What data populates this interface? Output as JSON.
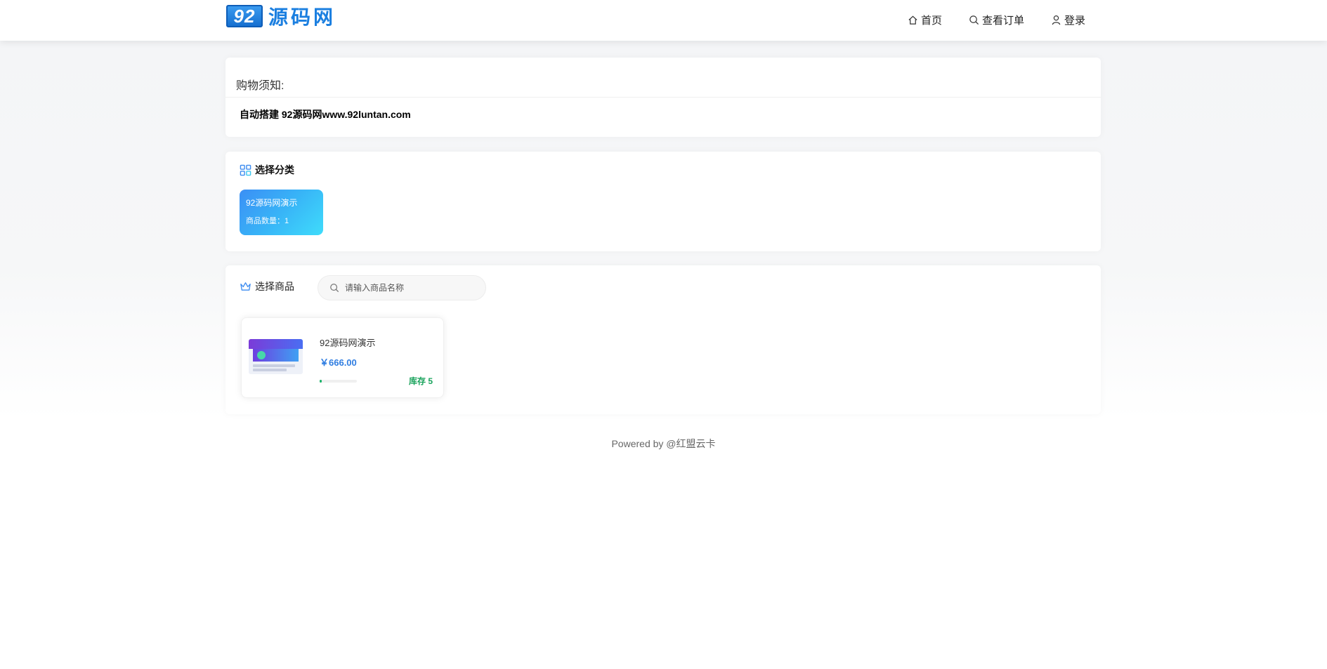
{
  "logo": {
    "badge": "92",
    "text": "源码网"
  },
  "nav": {
    "home": "首页",
    "orders": "查看订单",
    "login": "登录"
  },
  "notice": {
    "title": "购物须知:",
    "body": "自动搭建 92源码网www.92luntan.com"
  },
  "category": {
    "heading": "选择分类",
    "items": [
      {
        "name": "92源码网演示",
        "count": "商品数量：1"
      }
    ]
  },
  "goods": {
    "heading": "选择商品",
    "search_placeholder": "请输入商品名称",
    "items": [
      {
        "name": "92源码网演示",
        "price": "￥666.00",
        "stock": "库存 5",
        "stock_fill": 0.05
      }
    ]
  },
  "footer": "Powered by @红盟云卡",
  "colors": {
    "accent": "#2f7de1",
    "stock": "#1aa35c",
    "logo": "#1b7fe0"
  },
  "icons": [
    "home-icon",
    "search-icon",
    "user-icon",
    "category-icon",
    "crown-icon"
  ]
}
